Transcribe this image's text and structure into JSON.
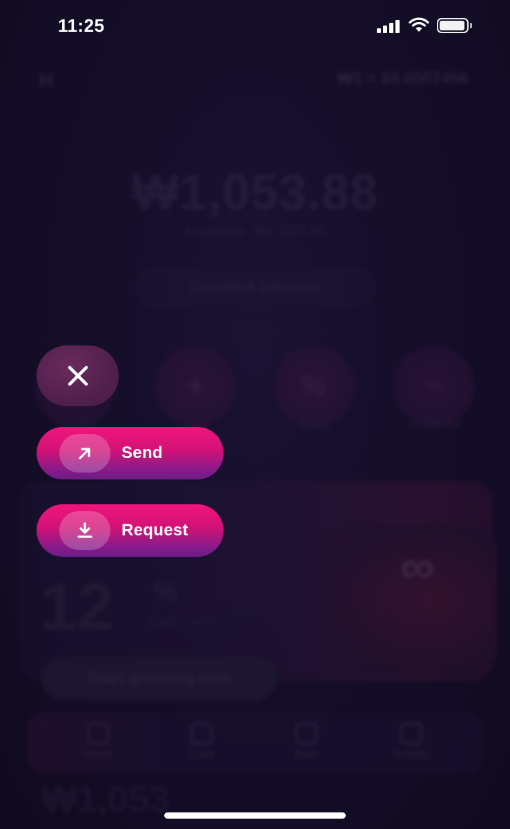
{
  "status_bar": {
    "time": "11:25"
  },
  "background": {
    "balance": "₩1,053.88",
    "available": "Available: ₩1,053.88",
    "rate": "₩1 = $0.0007456",
    "detailed_balance_label": "Detailed balance",
    "quick_actions": [
      "Transfer",
      "Add",
      "Grow",
      "Withdraw"
    ],
    "promo_percent": "12",
    "promo_percent_sign": "%",
    "promo_caption": "Daily yield",
    "promo_cta": "Start growing now",
    "tabs": [
      "Home",
      "Card",
      "Earn",
      "Activity"
    ],
    "bottom_text": "₩1,053"
  },
  "action_sheet": {
    "close_icon": "close-icon",
    "send": {
      "label": "Send",
      "icon": "arrow-up-right-icon"
    },
    "request": {
      "label": "Request",
      "icon": "download-icon"
    }
  },
  "colors": {
    "overlay_bg": "#120c24",
    "button_pink": "#f0157c",
    "button_purple": "#6b1c86",
    "close_bg": "#5a2454"
  }
}
